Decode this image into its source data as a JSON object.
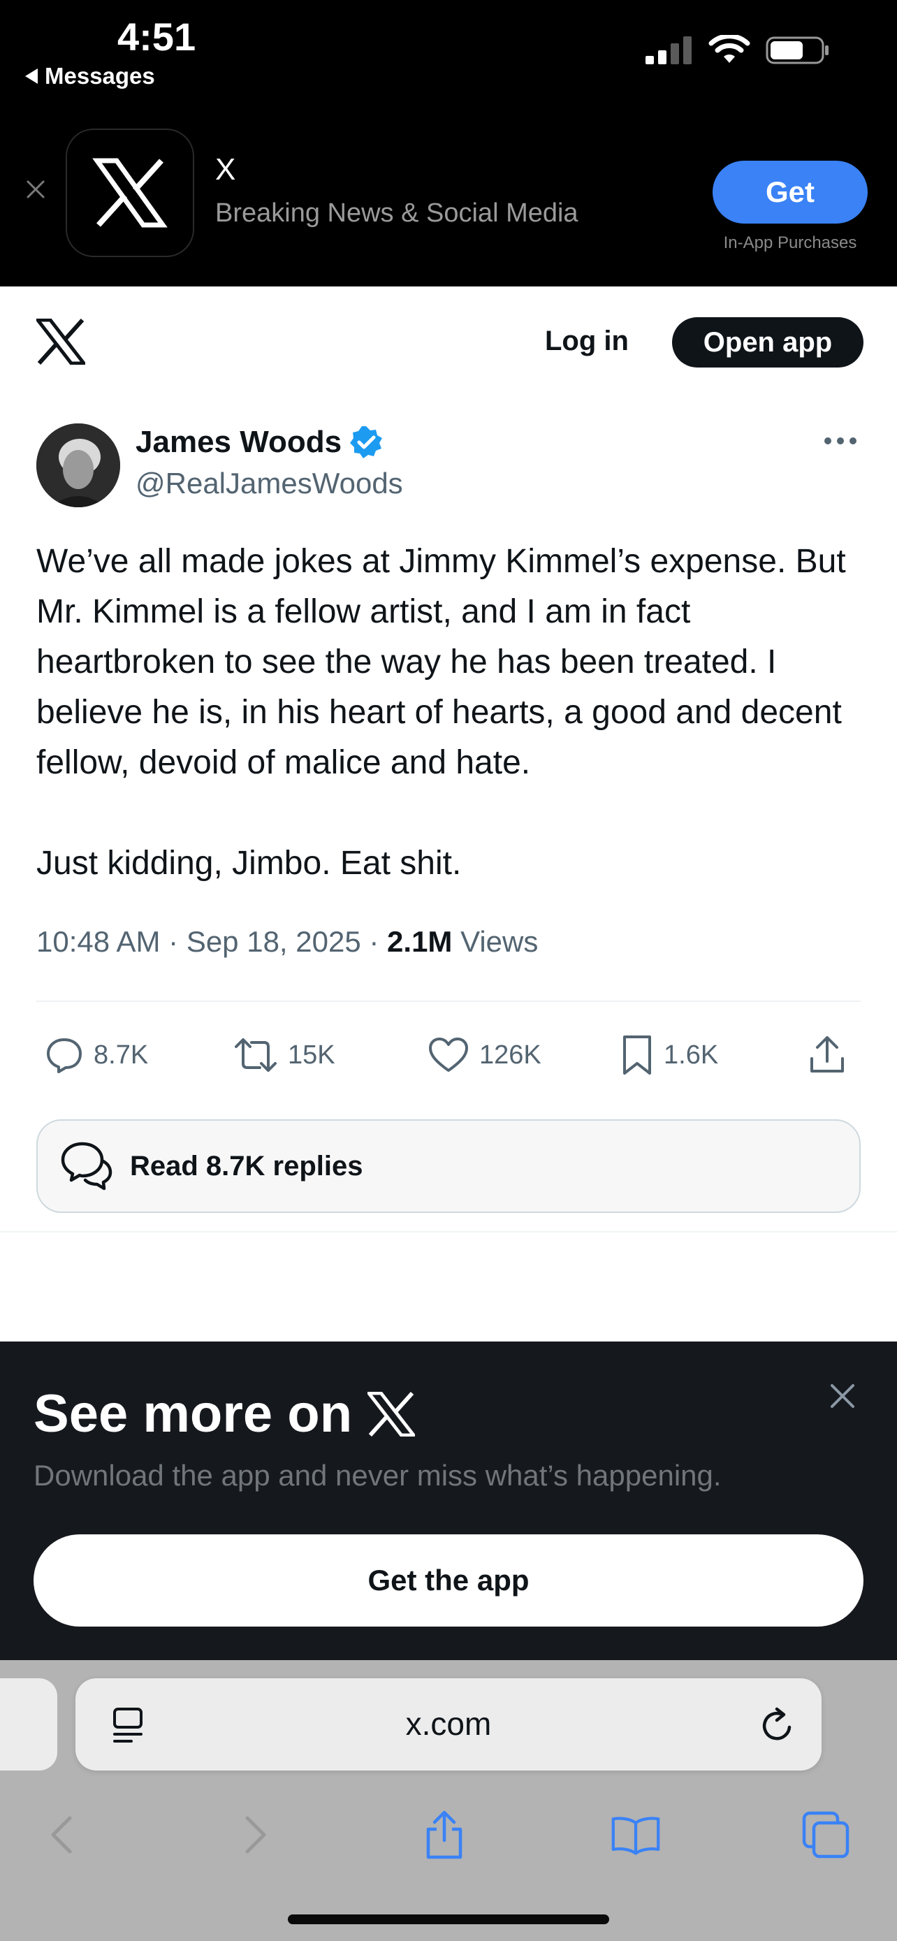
{
  "status_bar": {
    "time": "4:51",
    "back_label": "Messages"
  },
  "app_banner": {
    "app_name": "X",
    "app_subtitle": "Breaking News & Social Media",
    "get_label": "Get",
    "iap_label": "In-App Purchases"
  },
  "header": {
    "login_label": "Log in",
    "open_app_label": "Open app"
  },
  "tweet": {
    "author_name": "James Woods",
    "handle": "@RealJamesWoods",
    "verified": true,
    "text": "We’ve all made jokes at Jimmy Kimmel’s expense. But Mr. Kimmel is a fellow artist, and I am in fact heartbroken to see the way he has been treated. I believe he is, in his heart of hearts, a good and decent fellow, devoid of malice and hate.\n\nJust kidding, Jimbo. Eat shit.",
    "time": "10:48 AM",
    "date": "Sep 18, 2025",
    "views_count": "2.1M",
    "views_label": "Views",
    "separator": "·",
    "replies": "8.7K",
    "reposts": "15K",
    "likes": "126K",
    "bookmarks": "1.6K",
    "read_replies_label": "Read 8.7K replies"
  },
  "see_more": {
    "title": "See more on",
    "subtitle": "Download the app and never miss what’s happening.",
    "button_label": "Get the app"
  },
  "browser": {
    "url": "x.com"
  },
  "colors": {
    "accent_blue": "#3a82f6",
    "verified_blue": "#1d9bf0",
    "dark_text": "#0f1419",
    "muted_text": "#536471",
    "sheet_bg": "#15181d"
  }
}
